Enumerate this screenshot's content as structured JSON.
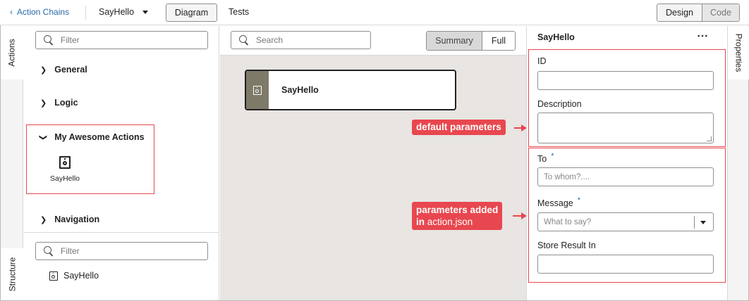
{
  "header": {
    "back_label": "Action Chains",
    "chain_name": "SayHello",
    "diagram_label": "Diagram",
    "tests_label": "Tests",
    "design_label": "Design",
    "code_label": "Code"
  },
  "left_rail": {
    "actions_tab": "Actions",
    "structure_tab": "Structure"
  },
  "actions_panel": {
    "filter_placeholder": "Filter",
    "categories": [
      {
        "label": "General",
        "expanded": false
      },
      {
        "label": "Logic",
        "expanded": false
      },
      {
        "label": "My Awesome Actions",
        "expanded": true
      },
      {
        "label": "Navigation",
        "expanded": false
      }
    ],
    "custom_action": {
      "label": "SayHello",
      "icon": "action-box-icon"
    }
  },
  "structure_panel": {
    "filter_placeholder": "Filter",
    "item_label": "SayHello"
  },
  "canvas": {
    "search_placeholder": "Search",
    "summary_label": "Summary",
    "full_label": "Full",
    "node_title": "SayHello"
  },
  "callouts": {
    "default_params": "default parameters",
    "added_line1": "parameters added",
    "added_line2_prefix": "in",
    "added_line2_plain": "action.json"
  },
  "properties": {
    "title": "SayHello",
    "more_icon": "ellipsis-icon",
    "id_label": "ID",
    "id_value": "",
    "description_label": "Description",
    "description_value": "",
    "to_label": "To",
    "to_required": "*",
    "to_placeholder": "To whom?....",
    "message_label": "Message",
    "message_required": "*",
    "message_placeholder": "What to say?",
    "store_label": "Store Result In",
    "store_value": ""
  },
  "right_rail": {
    "properties_tab": "Properties"
  },
  "colors": {
    "accent_red": "#e8474f",
    "link_blue": "#2a6aa8",
    "canvas_bg": "#e8e5e2"
  }
}
